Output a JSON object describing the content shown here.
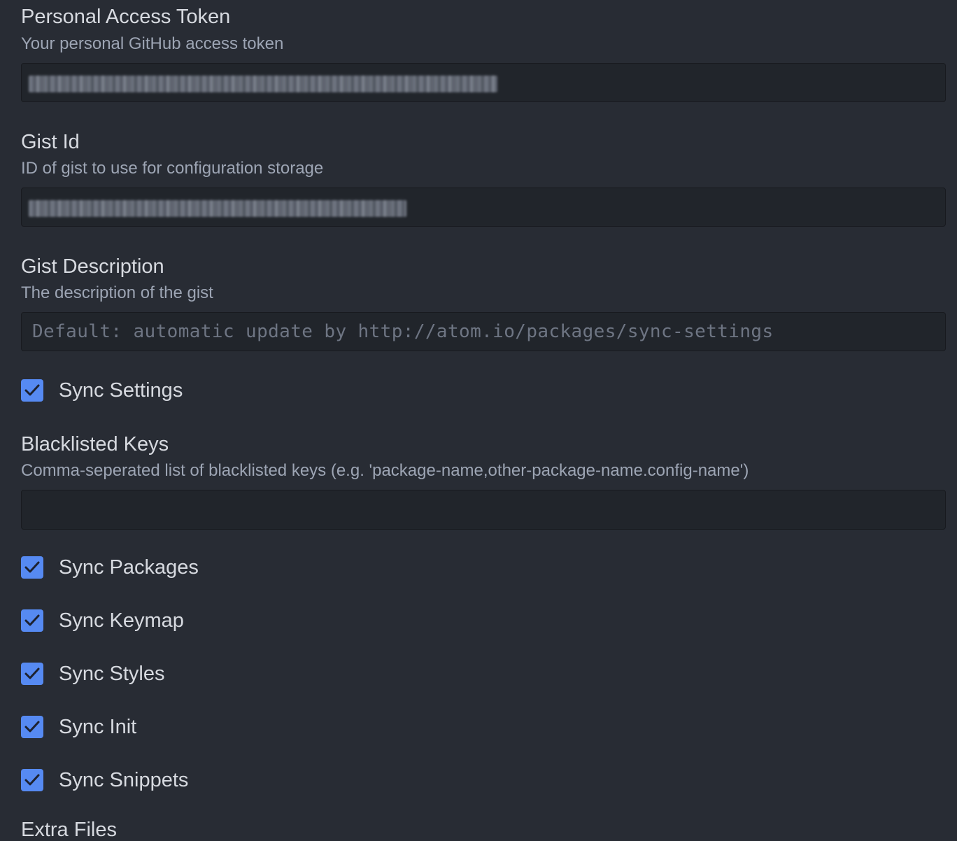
{
  "settings": {
    "personal_access_token": {
      "title": "Personal Access Token",
      "description": "Your personal GitHub access token"
    },
    "gist_id": {
      "title": "Gist Id",
      "description": "ID of gist to use for configuration storage"
    },
    "gist_description": {
      "title": "Gist Description",
      "description": "The description of the gist",
      "placeholder": "Default: automatic update by http://atom.io/packages/sync-settings"
    },
    "sync_settings": {
      "label": "Sync Settings",
      "checked": true
    },
    "blacklisted_keys": {
      "title": "Blacklisted Keys",
      "description": "Comma-seperated list of blacklisted keys (e.g. 'package-name,other-package-name.config-name')",
      "value": ""
    },
    "sync_packages": {
      "label": "Sync Packages",
      "checked": true
    },
    "sync_keymap": {
      "label": "Sync Keymap",
      "checked": true
    },
    "sync_styles": {
      "label": "Sync Styles",
      "checked": true
    },
    "sync_init": {
      "label": "Sync Init",
      "checked": true
    },
    "sync_snippets": {
      "label": "Sync Snippets",
      "checked": true
    },
    "extra_files": {
      "title": "Extra Files"
    }
  },
  "icons": {
    "checkbox": "checkmark-icon"
  },
  "colors": {
    "background": "#282c34",
    "input_background": "#21252b",
    "accent": "#568af2",
    "title_text": "#d7dae0",
    "description_text": "#9da5b4"
  }
}
